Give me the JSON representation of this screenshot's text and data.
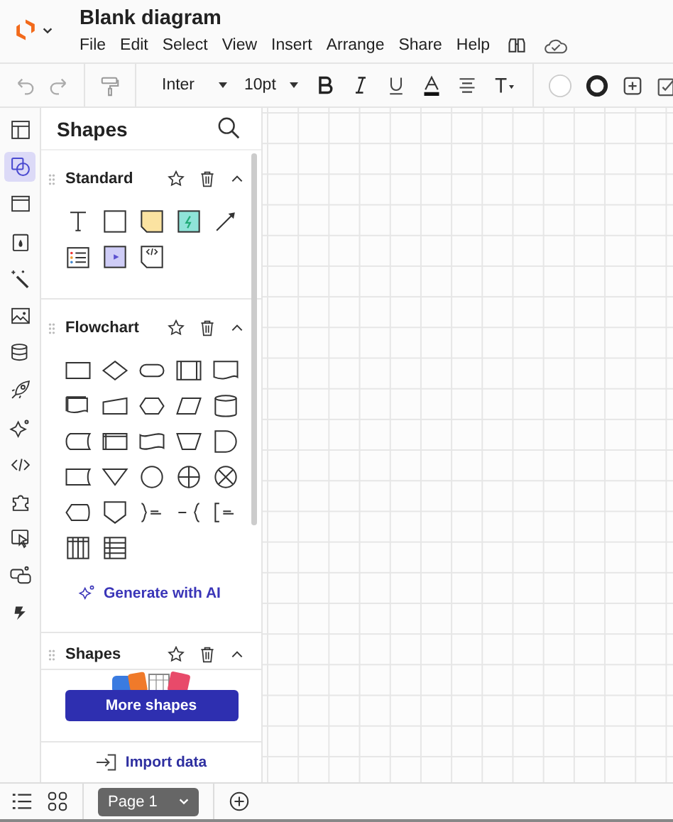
{
  "app": {
    "title": "Blank diagram",
    "menu": [
      "File",
      "Edit",
      "Select",
      "View",
      "Insert",
      "Arrange",
      "Share",
      "Help"
    ]
  },
  "toolbar": {
    "font": "Inter",
    "size": "10pt"
  },
  "rail": [
    {
      "selected": false
    },
    {
      "selected": true
    },
    {
      "selected": false
    },
    {
      "selected": false
    },
    {
      "selected": false
    },
    {
      "selected": false
    },
    {
      "selected": false
    },
    {
      "selected": false
    },
    {
      "selected": false
    },
    {
      "selected": false
    },
    {
      "selected": false
    },
    {
      "selected": false
    },
    {
      "selected": false
    },
    {
      "selected": false
    }
  ],
  "sidebar": {
    "title": "Shapes",
    "sections": [
      {
        "title": "Standard",
        "expanded": true
      },
      {
        "title": "Flowchart",
        "expanded": true
      },
      {
        "title": "Shapes",
        "expanded": true
      }
    ],
    "generate": "Generate with AI",
    "more_button": "More shapes",
    "import": "Import data"
  },
  "pages": [
    {
      "label": "Page 1",
      "selected": true
    }
  ]
}
